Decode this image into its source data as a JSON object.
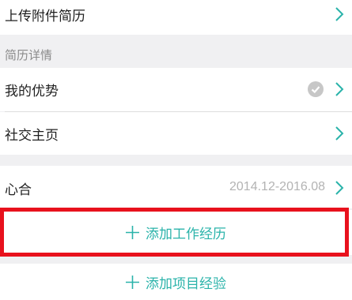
{
  "upload_row": {
    "label": "上传附件简历"
  },
  "resume_details": {
    "title": "简历详情"
  },
  "advantages_row": {
    "label": "我的优势"
  },
  "social_row": {
    "label": "社交主页"
  },
  "work_item": {
    "company": "心合",
    "dates": "2014.12-2016.08"
  },
  "add_work": {
    "label": "添加工作经历"
  },
  "add_project": {
    "label": "添加项目经验"
  },
  "colors": {
    "accent": "#2ab3aa",
    "highlight_border": "#e8111d",
    "background": "#f0f0f2"
  },
  "icons": {
    "chevron": "chevron-right-icon",
    "check": "check-circle-icon",
    "plus": "plus-icon"
  }
}
